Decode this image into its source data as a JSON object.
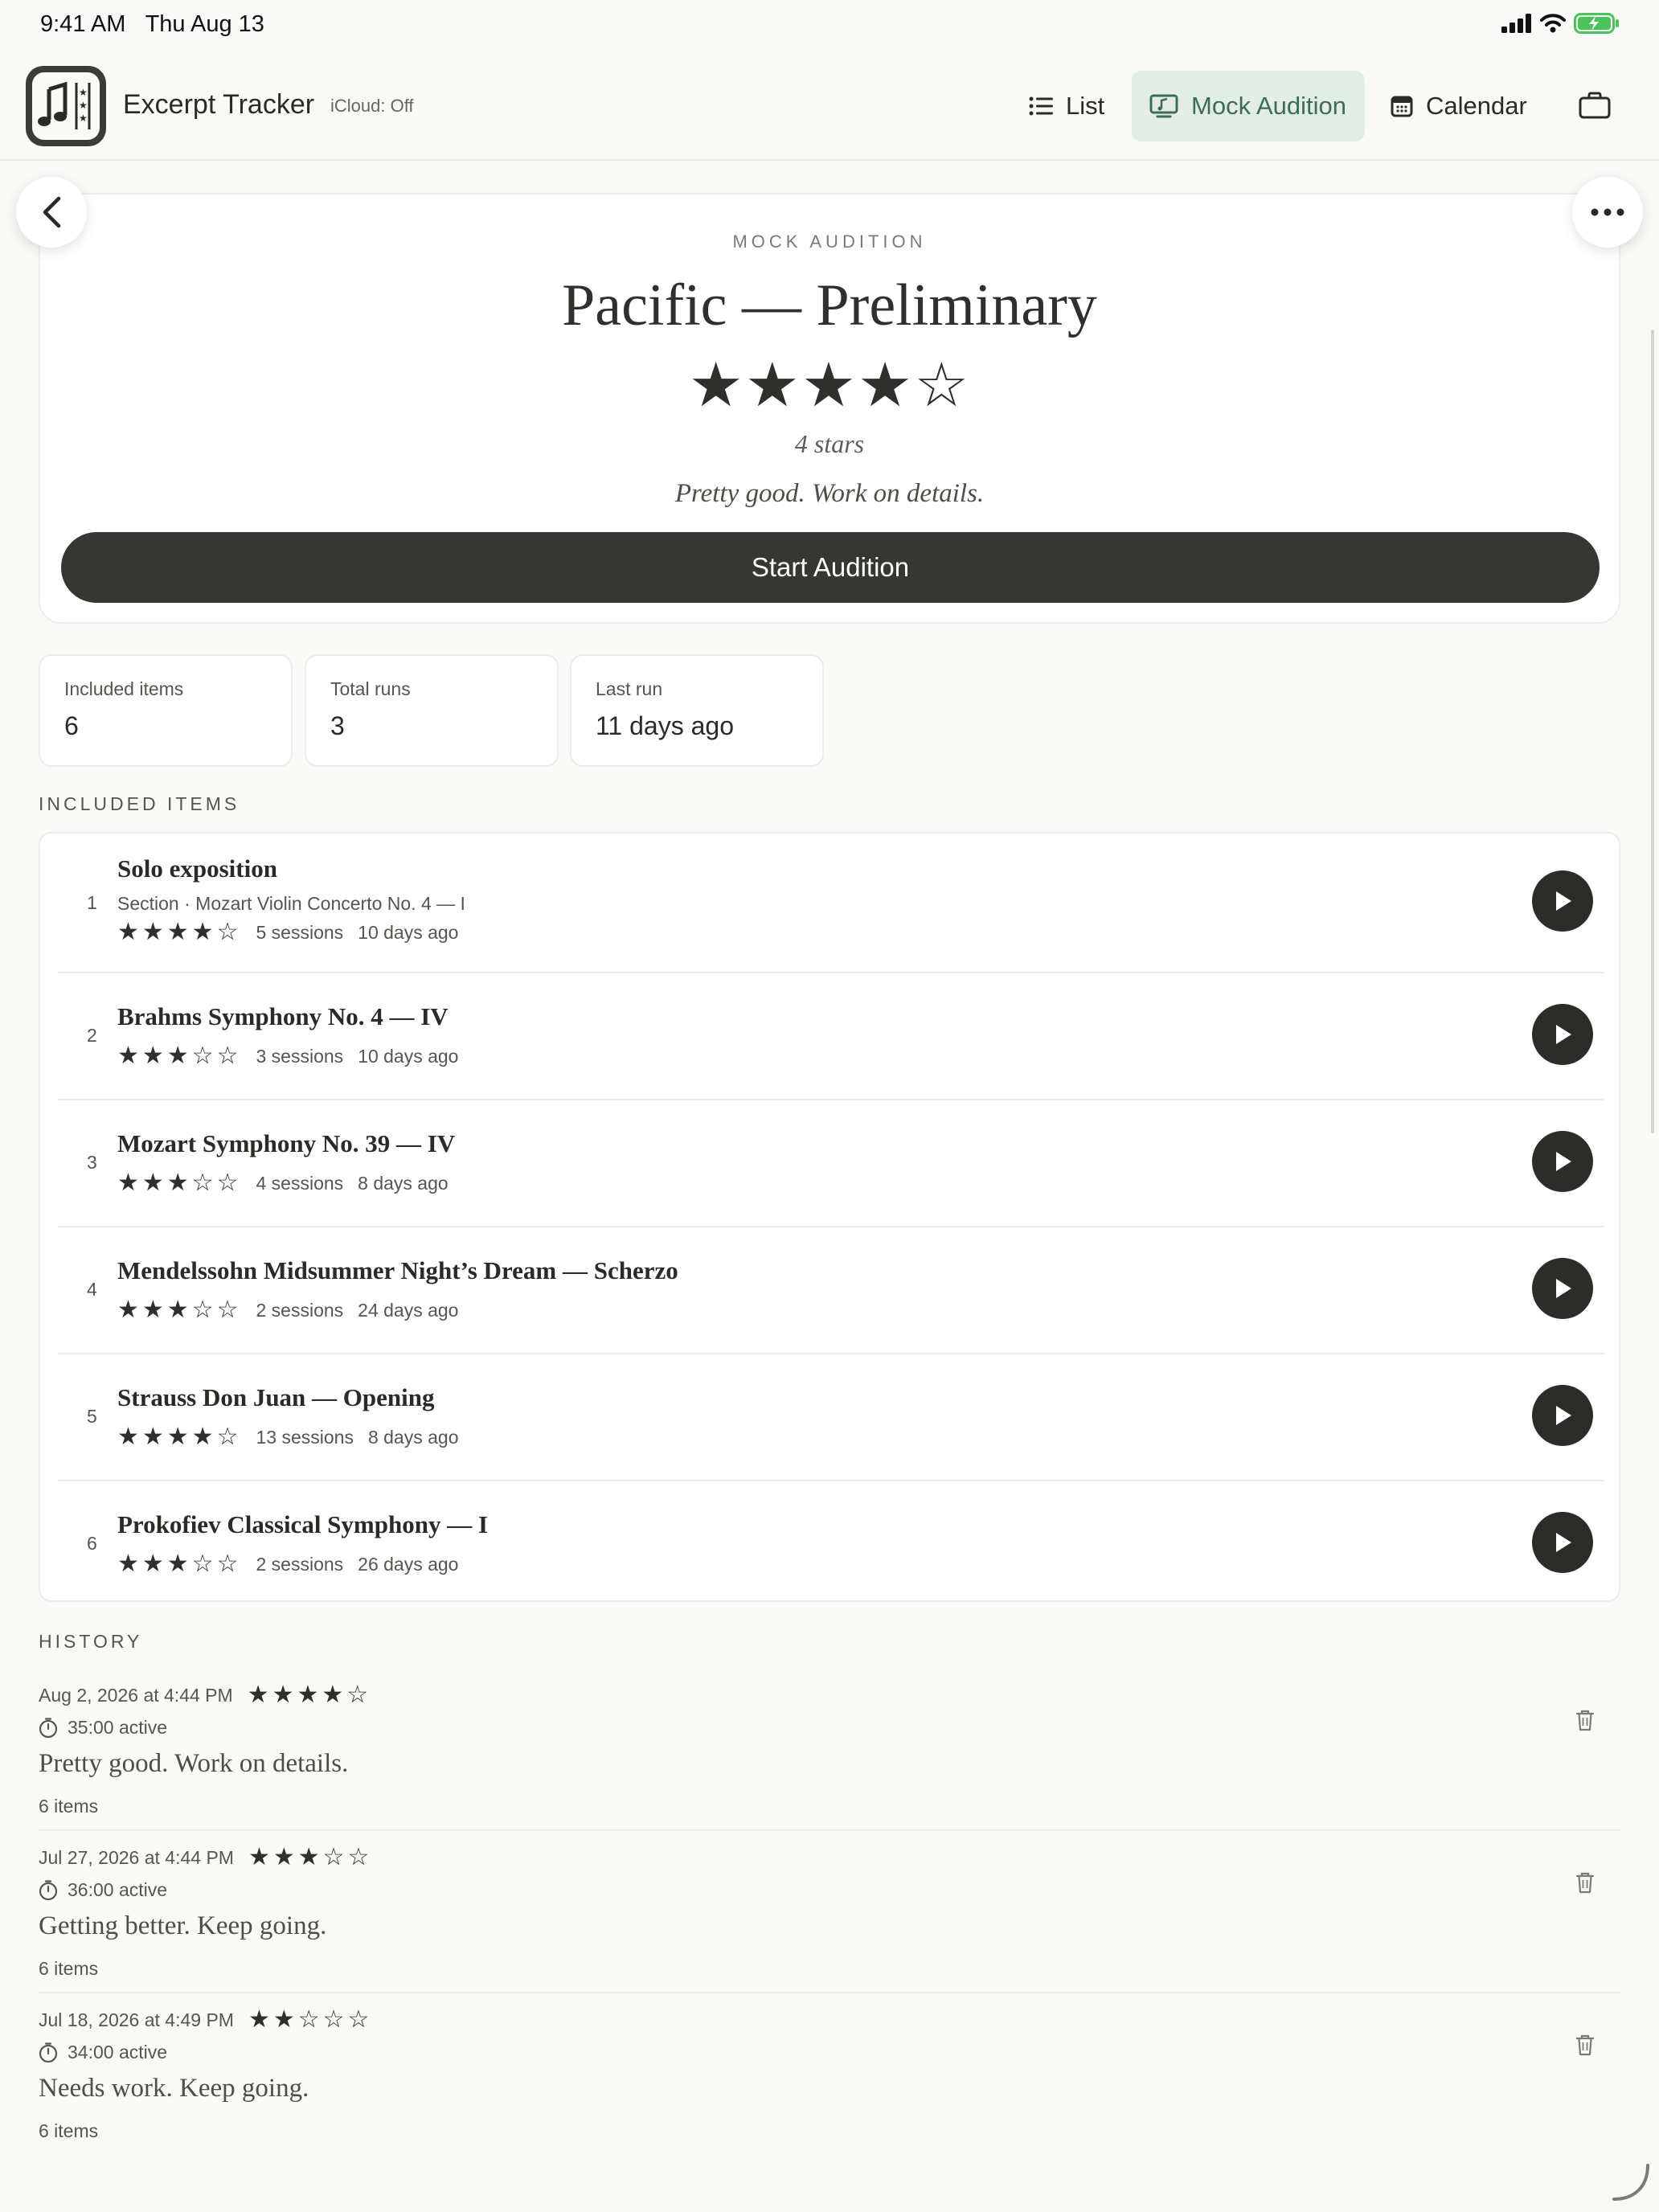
{
  "status": {
    "time": "9:41 AM",
    "date": "Thu Aug 13"
  },
  "app": {
    "title": "Excerpt Tracker",
    "icloud": "iCloud: Off"
  },
  "nav": {
    "list": "List",
    "mock": "Mock Audition",
    "calendar": "Calendar"
  },
  "header": {
    "eyebrow": "MOCK AUDITION",
    "title": "Pacific — Preliminary",
    "stars": "★★★★☆",
    "rating": 4,
    "stars_label": "4 stars",
    "note": "Pretty good. Work on details.",
    "start_label": "Start Audition"
  },
  "stats": [
    {
      "label": "Included items",
      "value": "6"
    },
    {
      "label": "Total runs",
      "value": "3"
    },
    {
      "label": "Last run",
      "value": "11 days ago"
    }
  ],
  "included_header": "INCLUDED ITEMS",
  "items": [
    {
      "num": "1",
      "title": "Solo exposition",
      "subtitle": "Section · Mozart Violin Concerto No. 4 — I",
      "stars": "★★★★☆",
      "sessions": "5 sessions",
      "ago": "10 days ago"
    },
    {
      "num": "2",
      "title": "Brahms Symphony No. 4 — IV",
      "stars": "★★★☆☆",
      "sessions": "3 sessions",
      "ago": "10 days ago"
    },
    {
      "num": "3",
      "title": "Mozart Symphony No. 39 — IV",
      "stars": "★★★☆☆",
      "sessions": "4 sessions",
      "ago": "8 days ago"
    },
    {
      "num": "4",
      "title": "Mendelssohn Midsummer Night’s Dream — Scherzo",
      "stars": "★★★☆☆",
      "sessions": "2 sessions",
      "ago": "24 days ago"
    },
    {
      "num": "5",
      "title": "Strauss Don Juan — Opening",
      "stars": "★★★★☆",
      "sessions": "13 sessions",
      "ago": "8 days ago"
    },
    {
      "num": "6",
      "title": "Prokofiev Classical Symphony — I",
      "stars": "★★★☆☆",
      "sessions": "2 sessions",
      "ago": "26 days ago"
    }
  ],
  "history_header": "HISTORY",
  "history": [
    {
      "date": "Aug 2, 2026 at 4:44 PM",
      "stars": "★★★★☆",
      "active": "35:00 active",
      "note": "Pretty good. Work on details.",
      "items": "6 items"
    },
    {
      "date": "Jul 27, 2026 at 4:44 PM",
      "stars": "★★★☆☆",
      "active": "36:00 active",
      "note": "Getting better. Keep going.",
      "items": "6 items"
    },
    {
      "date": "Jul 18, 2026 at 4:49 PM",
      "stars": "★★☆☆☆",
      "active": "34:00 active",
      "note": "Needs work. Keep going.",
      "items": "6 items"
    }
  ]
}
